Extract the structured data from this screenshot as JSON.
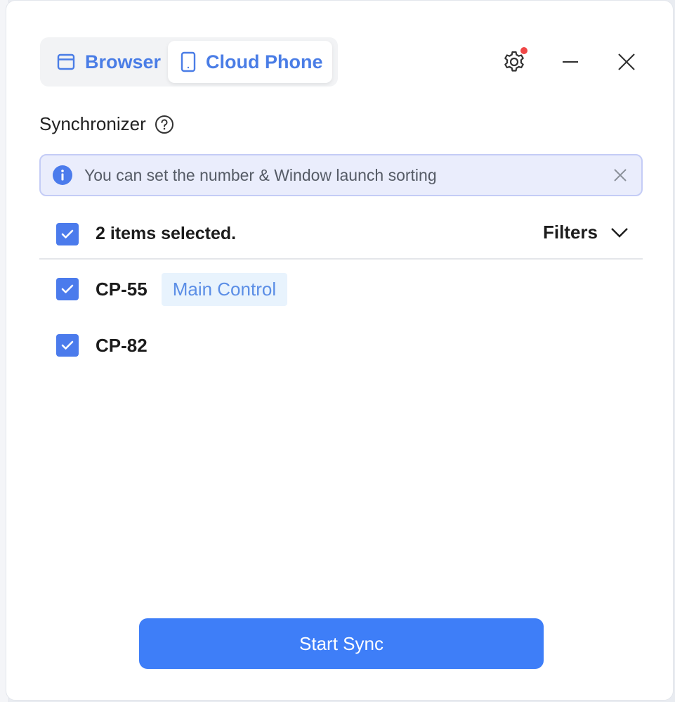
{
  "tabs": [
    {
      "label": "Browser",
      "icon": "browser-window-icon",
      "active": false
    },
    {
      "label": "Cloud Phone",
      "icon": "phone-icon",
      "active": true
    }
  ],
  "controls": {
    "settings_icon": "gear-icon",
    "settings_has_notification": true,
    "minimize_icon": "minimize-icon",
    "close_icon": "close-icon"
  },
  "section": {
    "title": "Synchronizer",
    "help_icon": "question-circle-icon"
  },
  "banner": {
    "text": "You can set the number & Window launch sorting",
    "icon": "info-icon"
  },
  "list": {
    "selected_text": "2 items selected.",
    "filters_label": "Filters",
    "items": [
      {
        "name": "CP-55",
        "tag": "Main Control",
        "checked": true
      },
      {
        "name": "CP-82",
        "tag": "",
        "checked": true
      }
    ]
  },
  "footer": {
    "start_label": "Start Sync"
  },
  "colors": {
    "accent": "#4b7bec",
    "button": "#3e7ef8",
    "banner_bg": "#eaedfc",
    "tag_bg": "#e8f3fd",
    "notification": "#f04747"
  }
}
